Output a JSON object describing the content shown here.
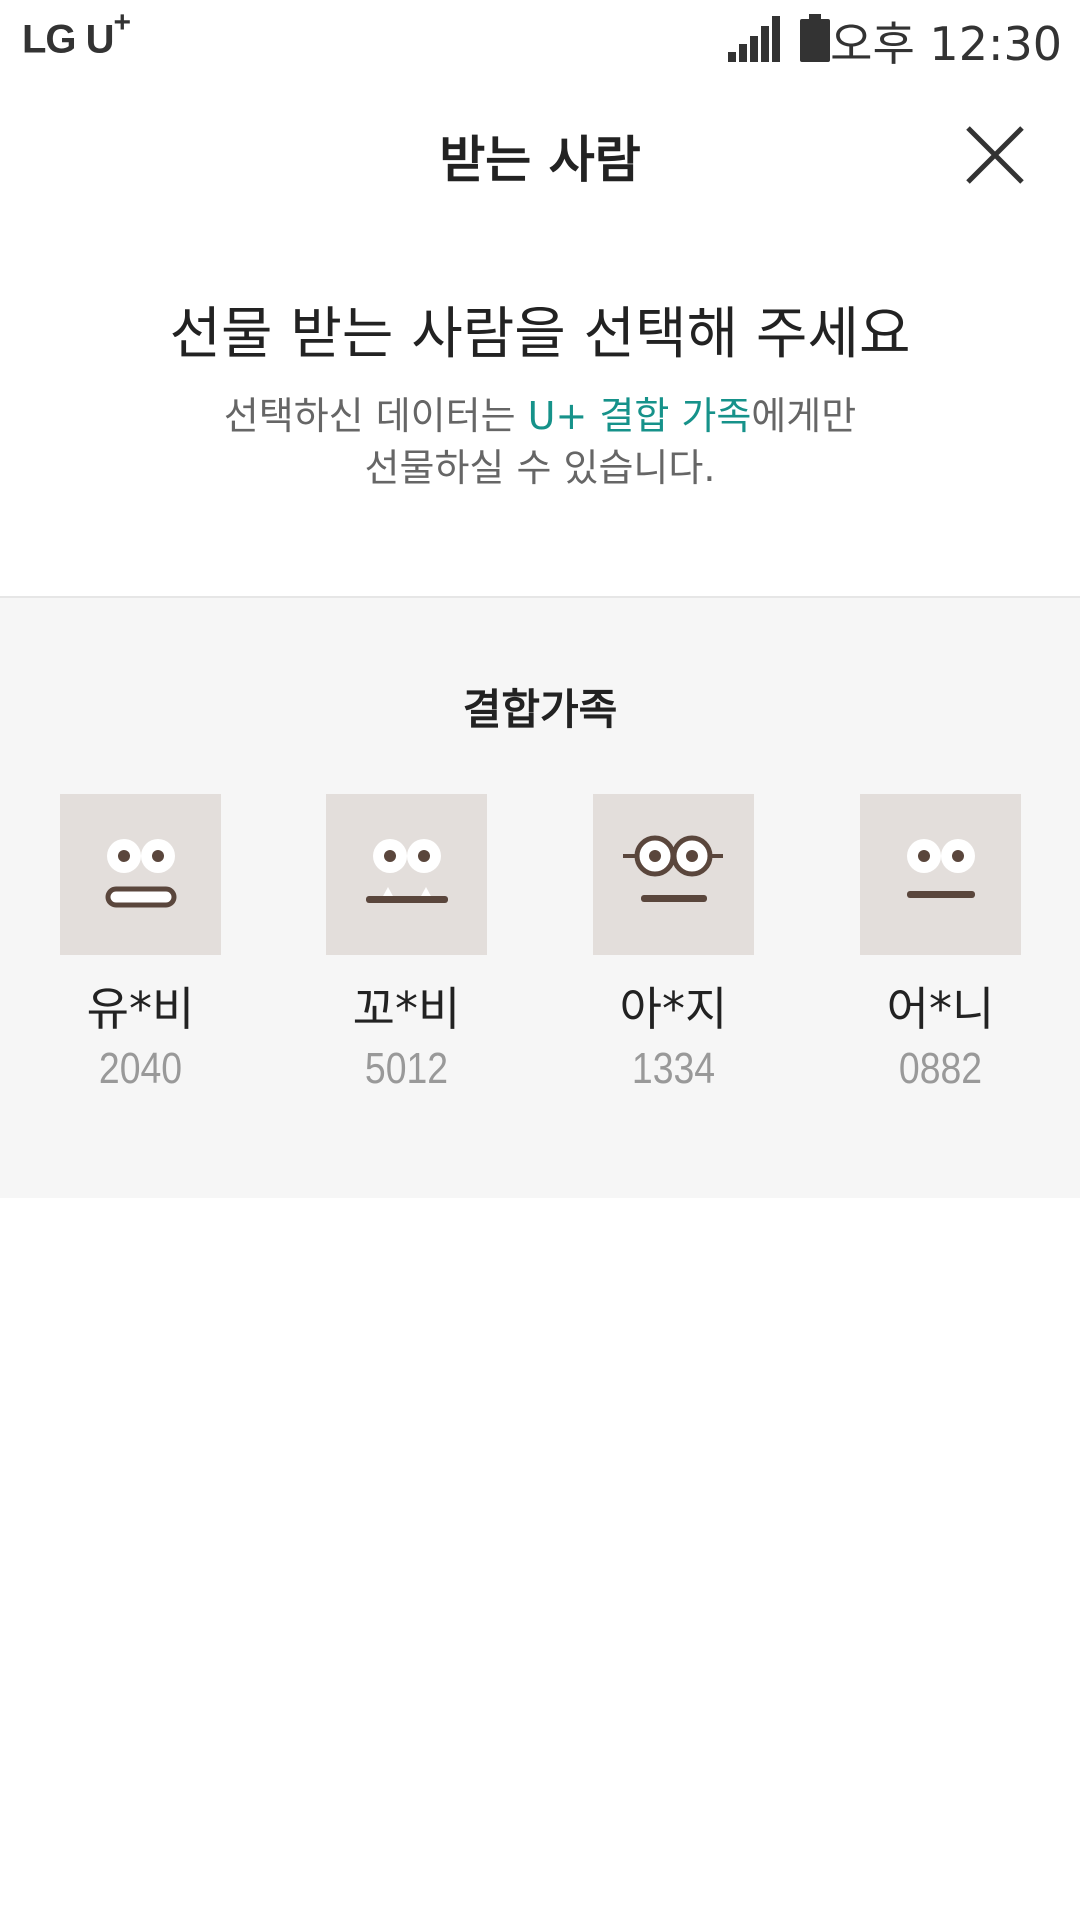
{
  "status_bar": {
    "carrier": "LG U",
    "carrier_plus": "+",
    "time": "오후 12:30",
    "icons": [
      "signal-icon",
      "battery-icon"
    ]
  },
  "header": {
    "title": "받는 사람",
    "close_icon": "close-icon"
  },
  "intro": {
    "title": "선물 받는 사람을 선택해 주세요",
    "desc_prefix": "선택하신 데이터는 ",
    "desc_highlight": "U+ 결합 가족",
    "desc_suffix": "에게만",
    "desc_line2": "선물하실 수 있습니다."
  },
  "family": {
    "title": "결합가족",
    "members": [
      {
        "name": "유*비",
        "number": "2040",
        "avatar": "avatar-teeth"
      },
      {
        "name": "꼬*비",
        "number": "5012",
        "avatar": "avatar-fangs"
      },
      {
        "name": "아*지",
        "number": "1334",
        "avatar": "avatar-glasses"
      },
      {
        "name": "어*니",
        "number": "0882",
        "avatar": "avatar-plain"
      }
    ]
  },
  "colors": {
    "accent": "#16928a",
    "avatar_bg": "#e3dedb",
    "avatar_feature": "#5a463c",
    "section_bg": "#f6f6f6"
  }
}
